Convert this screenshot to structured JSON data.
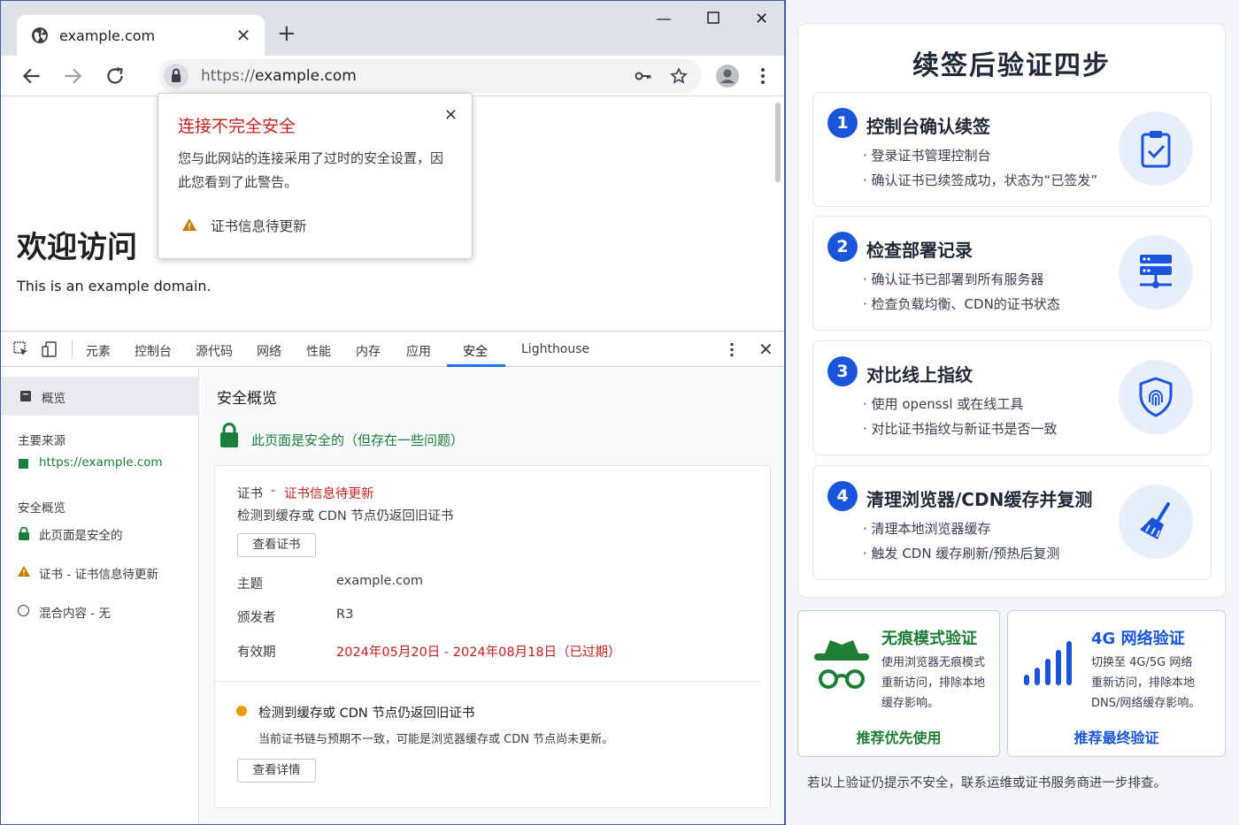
{
  "browser": {
    "tab_title": "example.com",
    "url_scheme": "https://",
    "url_host": "example.com",
    "page": {
      "heading": "欢迎访问",
      "subtext": "This is an example domain."
    },
    "popup": {
      "title": "连接不完全安全",
      "body": "您与此网站的连接采用了过时的安全设置，因此您看到了此警告。",
      "warning": "证书信息待更新"
    }
  },
  "devtools": {
    "tabs": [
      "元素",
      "控制台",
      "源代码",
      "网络",
      "性能",
      "内存",
      "应用",
      "安全",
      "Lighthouse"
    ],
    "active_tab": "安全",
    "sidebar": {
      "overview": "概览",
      "main_origin_label": "主要来源",
      "main_origin_url": "https://example.com",
      "security_overview_label": "安全概览",
      "page_secure": "此页面是安全的",
      "cert_item": "证书 - 证书信息待更新",
      "mixed_content": "混合内容 - 无"
    },
    "main": {
      "title": "安全概览",
      "secure_summary": "此页面是安全的（但存在一些问题）",
      "cert_label": "证书",
      "cert_dash": "-",
      "cert_status": "证书信息待更新",
      "cert_desc": "检测到缓存或 CDN 节点仍返回旧证书",
      "view_cert_button": "查看证书",
      "subject_label": "主题",
      "subject_value": "example.com",
      "issuer_label": "颁发者",
      "issuer_value": "R3",
      "validity_label": "有效期",
      "validity_value": "2024年05月20日 - 2024年08月18日（已过期）",
      "issue_title": "检测到缓存或 CDN 节点仍返回旧证书",
      "issue_desc": "当前证书链与预期不一致，可能是浏览器缓存或 CDN 节点尚未更新。",
      "view_details_button": "查看详情"
    }
  },
  "guide": {
    "title": "续签后验证四步",
    "steps": [
      {
        "num": "1",
        "title": "控制台确认续签",
        "bullets": [
          "登录证书管理控制台",
          "确认证书已续签成功，状态为“已签发”"
        ],
        "icon": "clipboard-check-icon"
      },
      {
        "num": "2",
        "title": "检查部署记录",
        "bullets": [
          "确认证书已部署到所有服务器",
          "检查负载均衡、CDN的证书状态"
        ],
        "icon": "server-icon"
      },
      {
        "num": "3",
        "title": "对比线上指纹",
        "bullets": [
          "使用 openssl 或在线工具",
          "对比证书指纹与新证书是否一致"
        ],
        "icon": "fingerprint-shield-icon"
      },
      {
        "num": "4",
        "title": "清理浏览器/CDN缓存并复测",
        "bullets": [
          "清理本地浏览器缓存",
          "触发 CDN 缓存刷新/预热后复测"
        ],
        "icon": "broom-icon"
      }
    ],
    "incognito": {
      "title": "无痕模式验证",
      "body": [
        "使用浏览器无痕模式",
        "重新访问，排除本地",
        "缓存影响。"
      ],
      "footer": "推荐优先使用",
      "color": "#1e7e34"
    },
    "mobile": {
      "title": "4G 网络验证",
      "body": [
        "切换至 4G/5G 网络",
        "重新访问，排除本地",
        "DNS/网络缓存影响。"
      ],
      "footer": "推荐最终验证",
      "color": "#1a56db"
    },
    "footnote": "若以上验证仍提示不安全，联系运维或证书服务商进一步排查。"
  }
}
